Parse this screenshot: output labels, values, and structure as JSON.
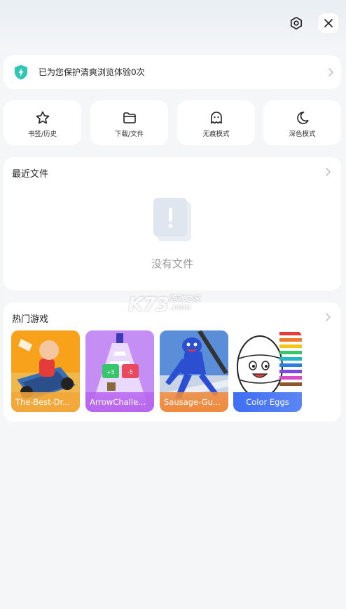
{
  "top_bar": {
    "settings_icon": "settings-hexagon-icon",
    "close_icon": "close-icon"
  },
  "protection": {
    "text": "已为您保护清爽浏览体验0次",
    "icon": "shield-bolt-icon",
    "accent": "#2fc7b3"
  },
  "quick_actions": [
    {
      "label": "书签/历史",
      "icon": "star-icon"
    },
    {
      "label": "下载/文件",
      "icon": "folder-icon"
    },
    {
      "label": "无痕模式",
      "icon": "ghost-icon"
    },
    {
      "label": "深色模式",
      "icon": "moon-icon"
    }
  ],
  "recent_files": {
    "title": "最近文件",
    "empty_text": "没有文件"
  },
  "hot_games": {
    "title": "热门游戏",
    "items": [
      {
        "name": "The-Best-Dr...",
        "color": "#f3a73a"
      },
      {
        "name": "ArrowChalle...",
        "color": "#b866f0"
      },
      {
        "name": "Sausage-Gu...",
        "color": "#f08a3c"
      },
      {
        "name": "Color Eggs",
        "color": "#4a73f0"
      }
    ]
  },
  "watermark": {
    "main": "K73",
    "sub1": "游戏之家",
    "sub2": ".com"
  }
}
